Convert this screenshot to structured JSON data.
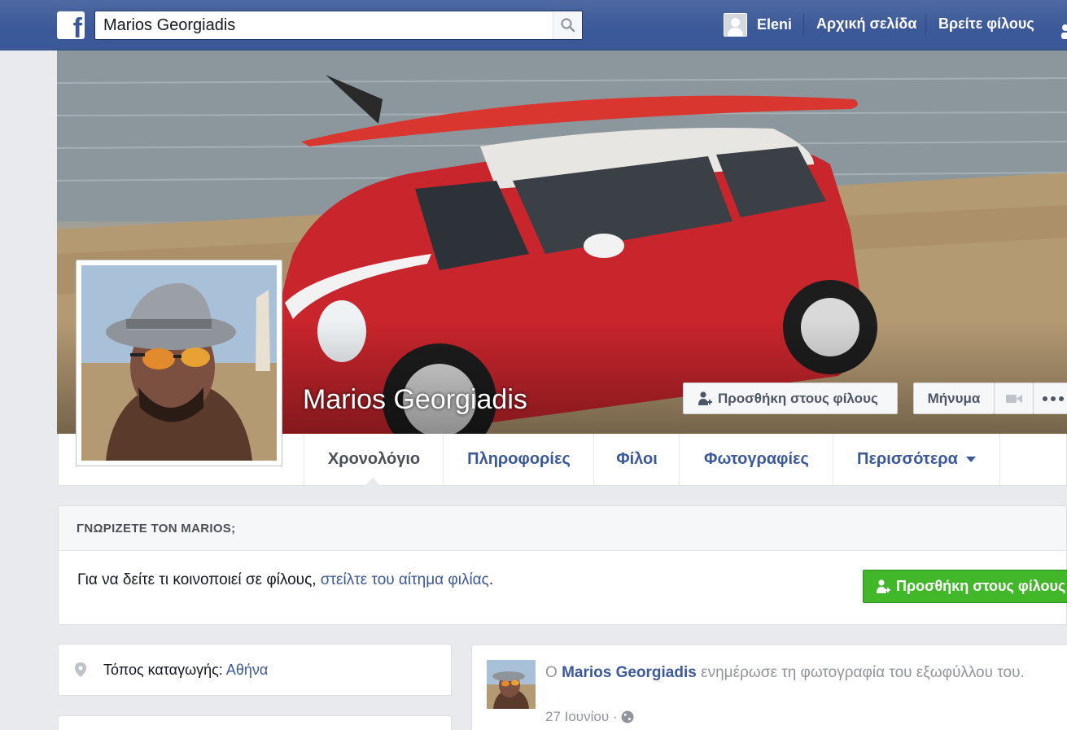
{
  "header": {
    "search_value": "Marios Georgiadis",
    "user_name": "Eleni",
    "nav_home": "Αρχική σελίδα",
    "nav_find_friends": "Βρείτε φίλους"
  },
  "profile": {
    "name": "Marios Georgiadis",
    "add_friend_label": "Προσθήκη στους φίλους",
    "message_label": "Μήνυμα"
  },
  "tabs": [
    {
      "label": "Χρονολόγιο"
    },
    {
      "label": "Πληροφορίες"
    },
    {
      "label": "Φίλοι"
    },
    {
      "label": "Φωτογραφίες"
    },
    {
      "label": "Περισσότερα"
    }
  ],
  "know_card": {
    "heading": "ΓΝΩΡΙΖΕΤΕ ΤΟΝ MARIOS;",
    "text_before": "Για να δείτε τι κοινοποιεί σε φίλους, ",
    "link_text": "στείλτε του αίτημα φιλίας",
    "text_after": ".",
    "button_label": "Προσθήκη στους φίλους"
  },
  "intro": {
    "hometown_label": "Τόπος καταγωγής: ",
    "hometown_value": "Αθήνα"
  },
  "post": {
    "prefix": "Ο ",
    "author": "Marios Georgiadis",
    "action": " ενημέρωσε τη φωτογραφία του εξωφύλλου του.",
    "date": "27 Ιουνίου",
    "separator": " · "
  },
  "colors": {
    "brand_blue": "#3b5998",
    "green_button": "#42b72a",
    "car_red": "#c9252c"
  }
}
